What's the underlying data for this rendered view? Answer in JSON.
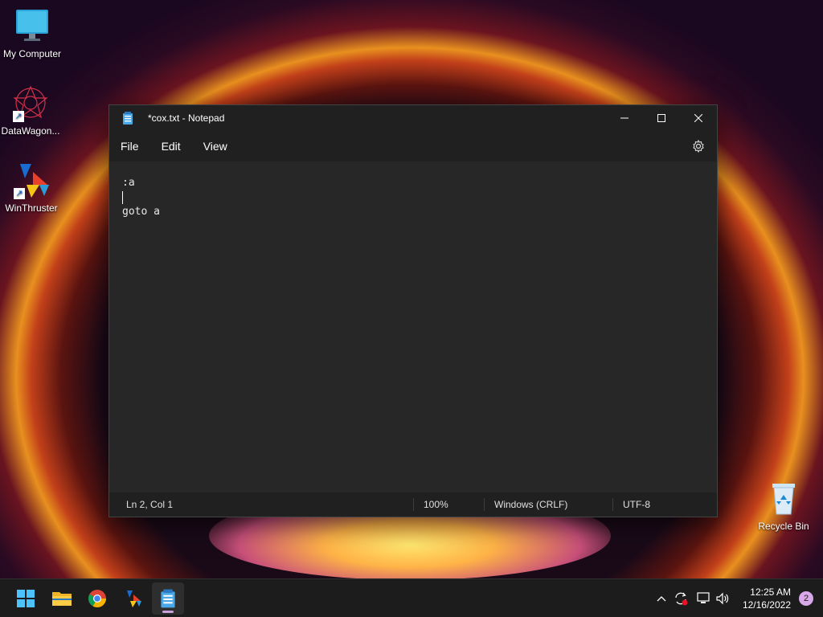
{
  "desktop": {
    "icons": [
      {
        "label": "My Computer"
      },
      {
        "label": "DataWagon..."
      },
      {
        "label": "WinThruster"
      },
      {
        "label": "Recycle Bin"
      }
    ]
  },
  "window": {
    "title": "*cox.txt - Notepad",
    "menu": [
      "File",
      "Edit",
      "View"
    ],
    "editor_lines": [
      ":a",
      "",
      "goto a"
    ],
    "status": {
      "position": "Ln 2, Col 1",
      "zoom": "100%",
      "line_ending": "Windows (CRLF)",
      "encoding": "UTF-8"
    }
  },
  "taskbar": {
    "apps": [
      "start",
      "file-explorer",
      "chrome",
      "winthruster",
      "notepad"
    ],
    "clock_time": "12:25 AM",
    "clock_date": "12/16/2022",
    "notification_count": "2"
  },
  "colors": {
    "accent": "#1a6cd0",
    "window_bg": "#272727",
    "titlebar_bg": "#202020",
    "taskbar_bg": "#1c1c1c"
  }
}
